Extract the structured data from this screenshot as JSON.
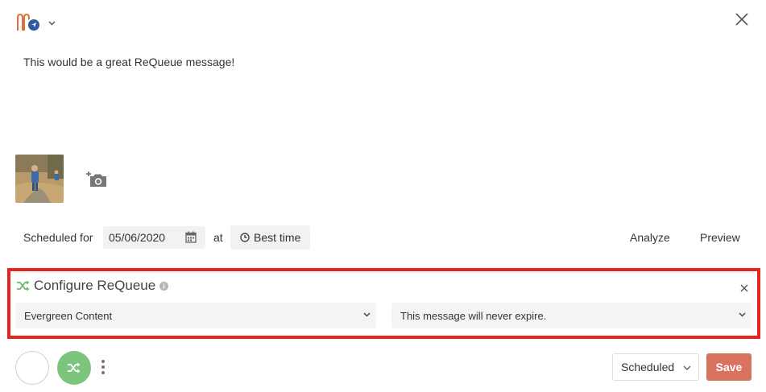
{
  "composer": {
    "message_text": "This would be a great ReQueue message!",
    "account_icon": "social-network-logo",
    "media_icon": "add-photo-icon"
  },
  "schedule": {
    "label": "Scheduled for",
    "date": "05/06/2020",
    "at_label": "at",
    "time_button": "Best time",
    "analyze_label": "Analyze",
    "preview_label": "Preview"
  },
  "requeue": {
    "title": "Configure ReQueue",
    "category_value": "Evergreen Content",
    "expiration_value": "This message will never expire."
  },
  "footer": {
    "status_value": "Scheduled",
    "save_label": "Save"
  },
  "colors": {
    "highlight_border": "#e8251a",
    "requeue_green": "#7dc47d",
    "save_button": "#d9725f"
  }
}
